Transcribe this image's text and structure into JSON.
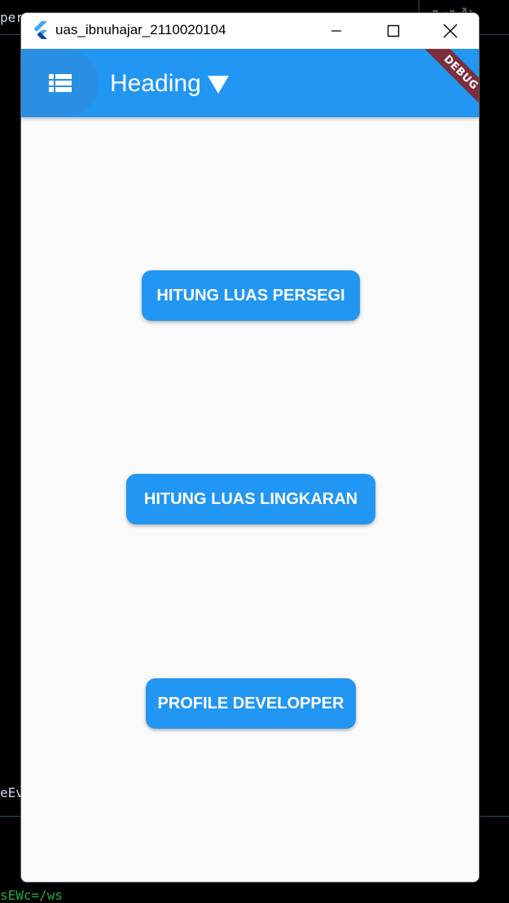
{
  "background": {
    "fragment_top": "per.t",
    "fragment_mid": "eEv",
    "fragment_bottom": "sEWc=/ws"
  },
  "window": {
    "title": "uas_ibnuhajar_2110020104",
    "controls": {
      "minimize_icon": "minimize-icon",
      "maximize_icon": "maximize-icon",
      "close_icon": "close-icon"
    }
  },
  "appbar": {
    "menu_icon": "list-icon",
    "title": "Heading",
    "dropdown_icon": "triangle-down-icon",
    "debug_banner": "DEBUG",
    "color": "#2196f3"
  },
  "buttons": [
    {
      "label": "HITUNG LUAS PERSEGI"
    },
    {
      "label": "HITUNG LUAS LINGKARAN"
    },
    {
      "label": "PROFILE DEVELOPPER"
    }
  ],
  "colors": {
    "primary": "#2196f3",
    "debug": "#7a2e3a",
    "background": "#fafafa"
  }
}
